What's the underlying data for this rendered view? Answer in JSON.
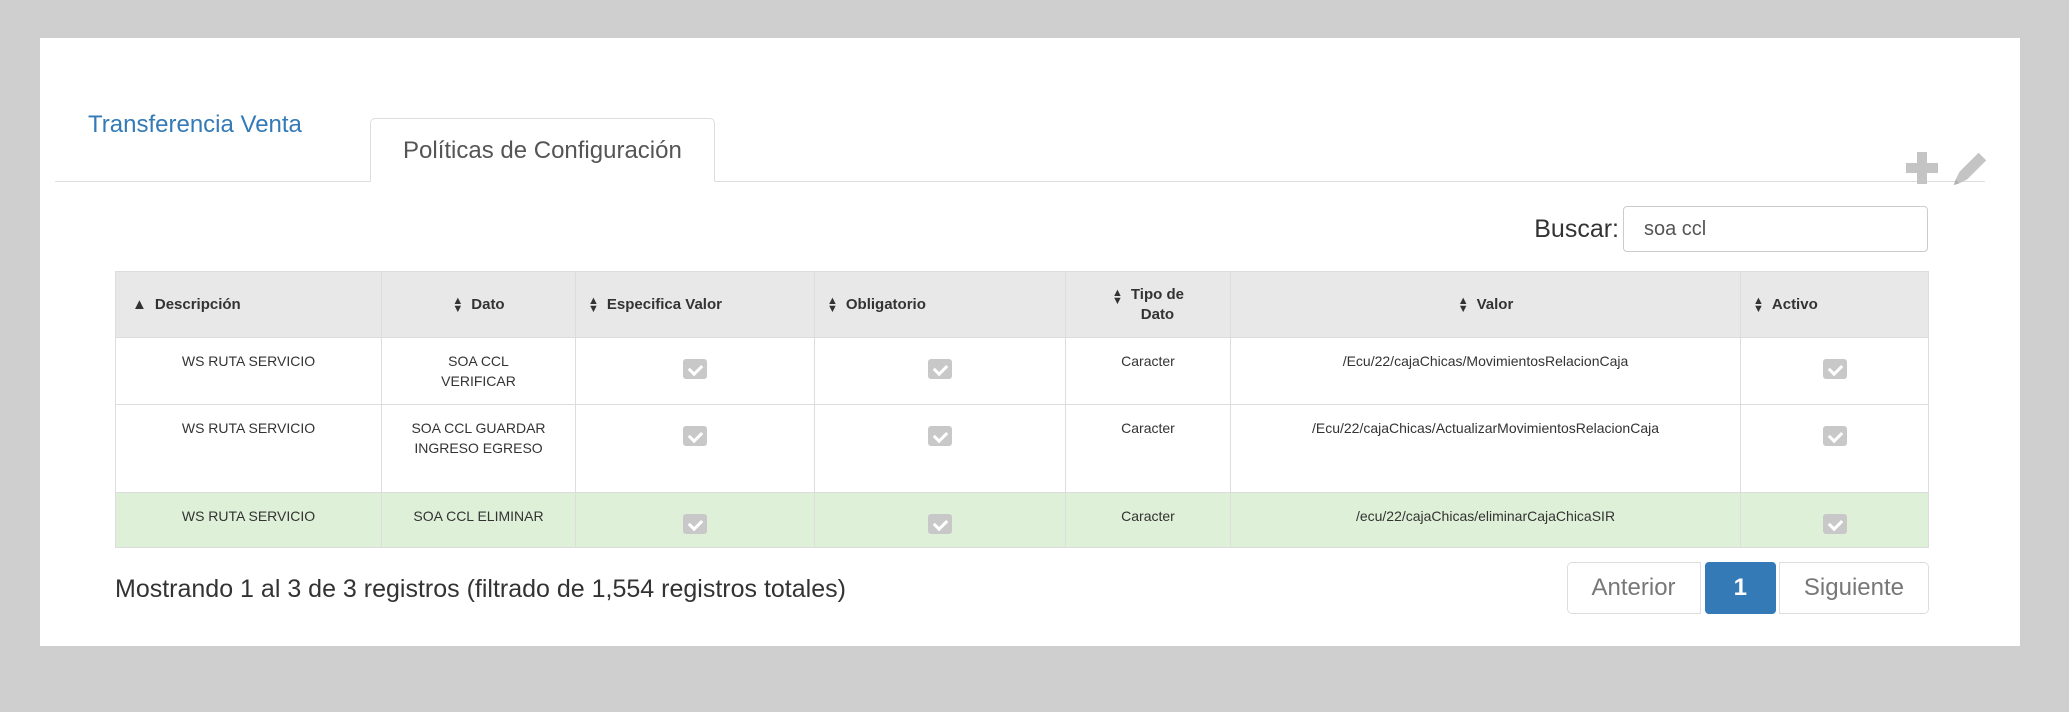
{
  "tabs": [
    {
      "label": "Transferencia Venta",
      "active": false
    },
    {
      "label": "Políticas de Configuración",
      "active": true
    }
  ],
  "toolbar": {
    "add_icon": "plus-icon",
    "edit_icon": "pencil-icon"
  },
  "search": {
    "label": "Buscar:",
    "value": "soa ccl"
  },
  "table": {
    "headers": {
      "descripcion": "Descripción",
      "dato": "Dato",
      "especifica_valor": "Especifica Valor",
      "obligatorio": "Obligatorio",
      "tipo_dato_line1": "Tipo de",
      "tipo_dato_line2": "Dato",
      "valor": "Valor",
      "activo": "Activo"
    },
    "rows": [
      {
        "descripcion": "WS RUTA SERVICIO",
        "dato": "SOA CCL VERIFICAR",
        "especifica_valor": true,
        "obligatorio": true,
        "tipo": "Caracter",
        "valor": "/Ecu/22/cajaChicas/MovimientosRelacionCaja",
        "activo": true
      },
      {
        "descripcion": "WS RUTA SERVICIO",
        "dato": "SOA CCL GUARDAR INGRESO EGRESO",
        "especifica_valor": true,
        "obligatorio": true,
        "tipo": "Caracter",
        "valor": "/Ecu/22/cajaChicas/ActualizarMovimientosRelacionCaja",
        "activo": true
      },
      {
        "descripcion": "WS RUTA SERVICIO",
        "dato": "SOA CCL ELIMINAR",
        "especifica_valor": true,
        "obligatorio": true,
        "tipo": "Caracter",
        "valor": "/ecu/22/cajaChicas/eliminarCajaChicaSIR",
        "activo": true
      }
    ]
  },
  "footer": {
    "info": "Mostrando 1 al 3 de 3 registros (filtrado de 1,554 registros totales)",
    "prev": "Anterior",
    "page": "1",
    "next": "Siguiente"
  },
  "colors": {
    "accent": "#337ab7",
    "selected_row": "#dff0d8",
    "header_bg": "#e8e8e8"
  }
}
